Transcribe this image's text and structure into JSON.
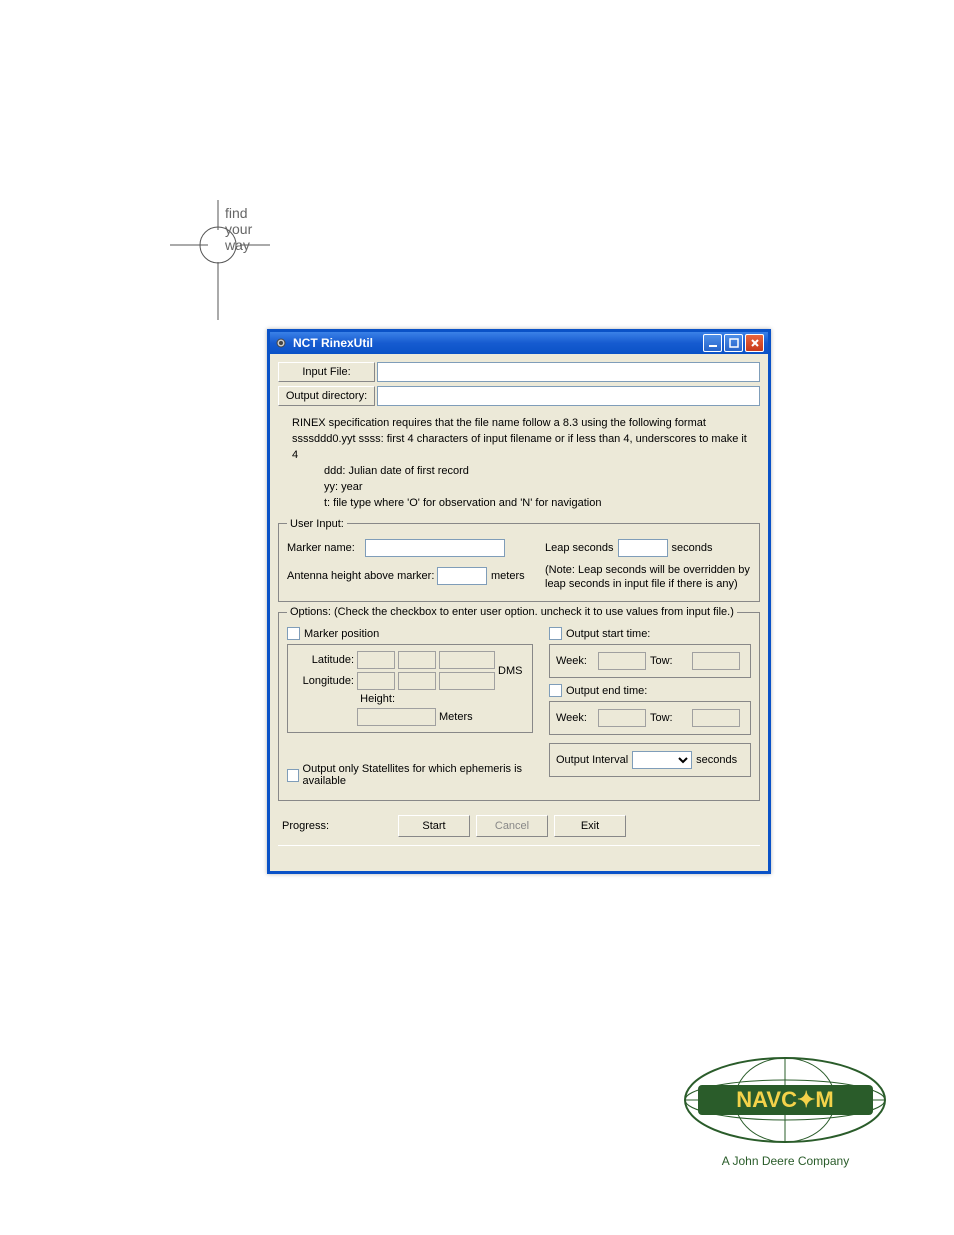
{
  "logo_text": {
    "l1": "find",
    "l2": "your",
    "l3": "way"
  },
  "window": {
    "title": "NCT RinexUtil",
    "input_file_btn": "Input File:",
    "output_dir_btn": "Output directory:",
    "input_file_value": "",
    "output_dir_value": ""
  },
  "spec": {
    "line1": "RINEX specification requires that the file name follow a 8.3 using the following format",
    "line2": "ssssddd0.yyt   ssss: first 4 characters of input filename or if less than 4, underscores to make it 4",
    "line3": "ddd: Julian date of first record",
    "line4": "yy: year",
    "line5": "t: file type where 'O' for observation and 'N' for navigation"
  },
  "user_input": {
    "legend": "User Input:",
    "marker_name_label": "Marker name:",
    "marker_name_value": "",
    "leap_label": "Leap seconds",
    "leap_value": "",
    "leap_unit": "seconds",
    "ant_label": "Antenna height above marker:",
    "ant_value": "",
    "ant_unit": "meters",
    "leap_note": "(Note: Leap seconds will be overridden by leap seconds in input file if there is any)"
  },
  "options": {
    "legend": "Options: (Check the checkbox to enter user option. uncheck it to use values from input file.)",
    "marker_position": "Marker position",
    "latitude": "Latitude:",
    "longitude": "Longitude:",
    "height": "Height:",
    "dms": "DMS",
    "meters": "Meters",
    "output_start": "Output start time:",
    "output_end": "Output end time:",
    "week": "Week:",
    "tow": "Tow:",
    "output_interval": "Output Interval",
    "interval_unit": "seconds",
    "sat_filter": "Output only Statellites for which ephemeris is available"
  },
  "buttons": {
    "progress": "Progress:",
    "start": "Start",
    "cancel": "Cancel",
    "exit": "Exit"
  },
  "navcom_tag": "A John Deere Company"
}
